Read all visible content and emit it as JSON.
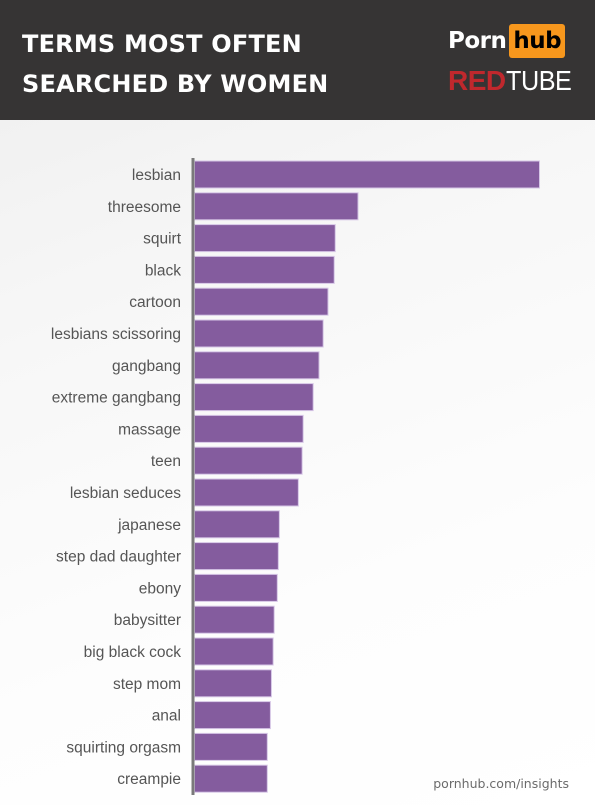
{
  "header": {
    "title_lines": [
      "TERMS MOST OFTEN",
      "SEARCHED BY WOMEN"
    ],
    "logos": {
      "pornhub": {
        "part1": "Porn",
        "part2": "hub",
        "accent": "#f7971d"
      },
      "redtube": {
        "part1": "RED",
        "part2": "TUBE",
        "accent": "#c0282d"
      }
    },
    "background": "#363434"
  },
  "chart_data": {
    "type": "bar",
    "orientation": "horizontal",
    "title": "TERMS MOST OFTEN SEARCHED BY WOMEN",
    "xlabel": "",
    "ylabel": "",
    "value_units": "relative (lesbian = 100); no numeric axis shown",
    "xlim": [
      0,
      100
    ],
    "grid": false,
    "legend": "none",
    "bar_color": "#845c9e",
    "categories": [
      "lesbian",
      "threesome",
      "squirt",
      "black",
      "cartoon",
      "lesbians scissoring",
      "gangbang",
      "extreme gangbang",
      "massage",
      "teen",
      "lesbian seduces",
      "japanese",
      "step dad daughter",
      "ebony",
      "babysitter",
      "big black cock",
      "step mom",
      "anal",
      "squirting orgasm",
      "creampie"
    ],
    "values": [
      100,
      47.4,
      40.8,
      40.5,
      38.7,
      37.3,
      36.1,
      34.4,
      31.5,
      31.2,
      30.1,
      24.6,
      24.3,
      24.0,
      23.1,
      22.8,
      22.3,
      22.0,
      21.1,
      21.1
    ]
  },
  "footer": {
    "source": "pornhub.com/insights"
  }
}
